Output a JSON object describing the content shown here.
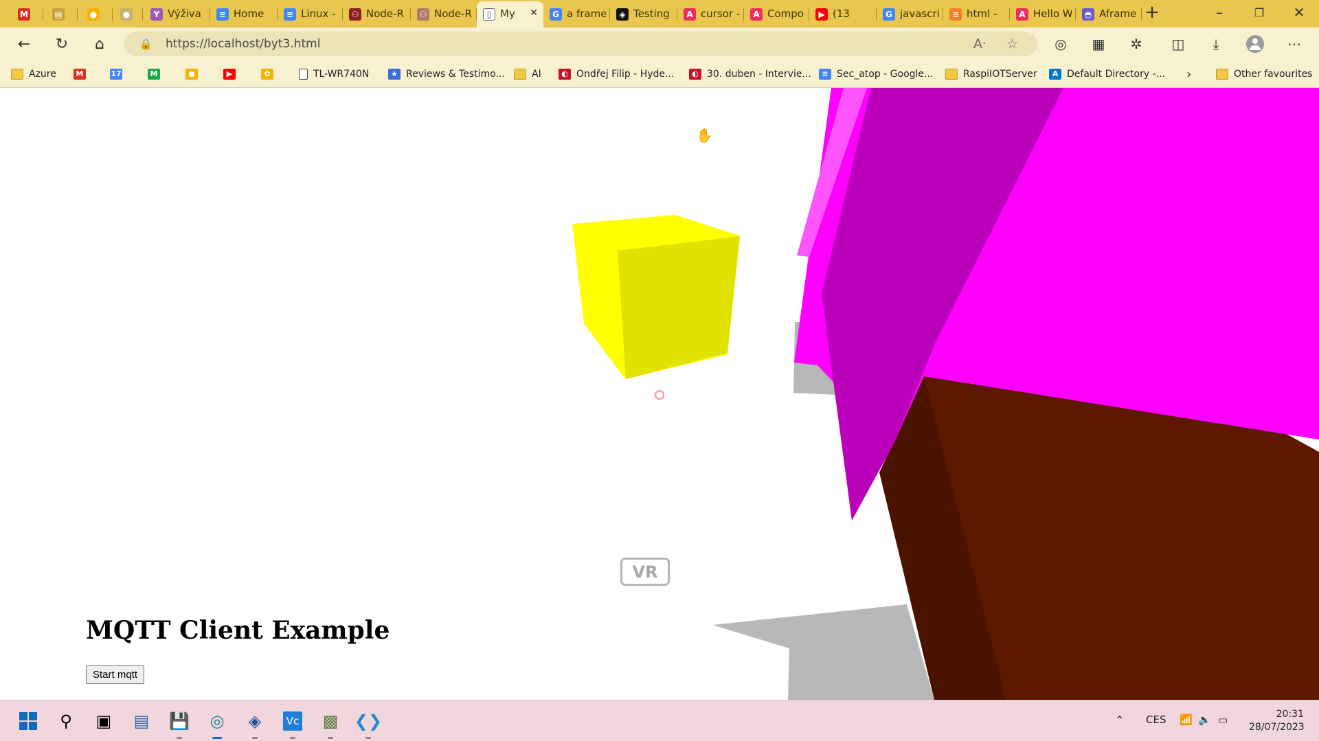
{
  "browser": {
    "tabs": [
      {
        "title": "",
        "icon": "gmail-icon",
        "color": "#d93025",
        "glyph": "M"
      },
      {
        "title": "",
        "icon": "calendar-icon",
        "color": "#c9a13a",
        "glyph": "▤"
      },
      {
        "title": "",
        "icon": "keep-icon",
        "color": "#f6b400",
        "glyph": "●"
      },
      {
        "title": "",
        "icon": "generic-icon",
        "color": "#c7b070",
        "glyph": "●"
      },
      {
        "title": "Výživa",
        "icon": "yahoo-icon",
        "color": "#9b59b6",
        "glyph": "Y"
      },
      {
        "title": "Home",
        "icon": "docs-icon",
        "color": "#4285f4",
        "glyph": "≡"
      },
      {
        "title": "Linux -",
        "icon": "docs-icon",
        "color": "#4285f4",
        "glyph": "≡"
      },
      {
        "title": "Node-R",
        "icon": "nodered-icon",
        "color": "#8f1f1f",
        "glyph": "⚇"
      },
      {
        "title": "Node-R",
        "icon": "nodered-icon",
        "color": "#b07a6a",
        "glyph": "⚇"
      },
      {
        "title": "My",
        "icon": "page-icon",
        "color": "#ffffff",
        "glyph": "▯",
        "active": true
      },
      {
        "title": "a frame",
        "icon": "google-icon",
        "color": "#4285f4",
        "glyph": "G"
      },
      {
        "title": "Testing",
        "icon": "codepen-icon",
        "color": "#111111",
        "glyph": "◈"
      },
      {
        "title": "cursor -",
        "icon": "aframe-icon",
        "color": "#ef2d5e",
        "glyph": "A"
      },
      {
        "title": "Compo",
        "icon": "aframe-icon",
        "color": "#ef2d5e",
        "glyph": "A"
      },
      {
        "title": "(13",
        "icon": "youtube-icon",
        "color": "#ff0000",
        "glyph": "▶"
      },
      {
        "title": "javascri",
        "icon": "google-icon",
        "color": "#4285f4",
        "glyph": "G"
      },
      {
        "title": "html -",
        "icon": "stackoverflow-icon",
        "color": "#f48024",
        "glyph": "≋"
      },
      {
        "title": "Hello W",
        "icon": "aframe-icon",
        "color": "#ef2d5e",
        "glyph": "A"
      },
      {
        "title": "Aframe",
        "icon": "aframe-logo-icon",
        "color": "#6a5acd",
        "glyph": "◓"
      }
    ],
    "url": "https://localhost/byt3.html",
    "bookmarks": [
      {
        "label": "Azure",
        "icon": "folder-icon"
      },
      {
        "label": "",
        "icon": "gmail-icon"
      },
      {
        "label": "",
        "icon": "calendar-icon"
      },
      {
        "label": "",
        "icon": "m-icon"
      },
      {
        "label": "",
        "icon": "keep-icon"
      },
      {
        "label": "",
        "icon": "youtube-icon"
      },
      {
        "label": "",
        "icon": "photos-icon"
      },
      {
        "label": "TL-WR740N",
        "icon": "page-icon"
      },
      {
        "label": "Reviews & Testimo...",
        "icon": "star-badge-icon"
      },
      {
        "label": "AI",
        "icon": "folder-icon"
      },
      {
        "label": "Ondřej Filip - Hyde...",
        "icon": "cz-icon"
      },
      {
        "label": "30. duben - Intervie...",
        "icon": "cz-icon"
      },
      {
        "label": "Sec_atop - Google...",
        "icon": "docs-icon"
      },
      {
        "label": "RaspiIOTServer",
        "icon": "folder-icon"
      },
      {
        "label": "Default Directory -...",
        "icon": "azure-icon"
      }
    ],
    "other_favourites": "Other favourites"
  },
  "scene": {
    "vr_label": "VR",
    "colors": {
      "yellow_front": "#ffff00",
      "yellow_side": "#e2e200",
      "magenta": "#ff00ff",
      "magenta_dark": "#bb00bb",
      "magenta_light": "#ff55ff",
      "brown": "#5e1800",
      "brown_dark": "#4a1300",
      "gray": "#b8b8b8"
    }
  },
  "page": {
    "heading": "MQTT Client Example",
    "button_label": "Start mqtt"
  },
  "taskbar": {
    "apps": [
      {
        "name": "start-icon"
      },
      {
        "name": "search-icon"
      },
      {
        "name": "task-view-icon"
      },
      {
        "name": "file-app-icon"
      },
      {
        "name": "save-app-icon"
      },
      {
        "name": "edge-icon"
      },
      {
        "name": "sketchup-icon"
      },
      {
        "name": "vc-app-icon"
      },
      {
        "name": "network-app-icon"
      },
      {
        "name": "vscode-icon"
      }
    ],
    "language": "CES",
    "time": "20:31",
    "date": "28/07/2023"
  }
}
